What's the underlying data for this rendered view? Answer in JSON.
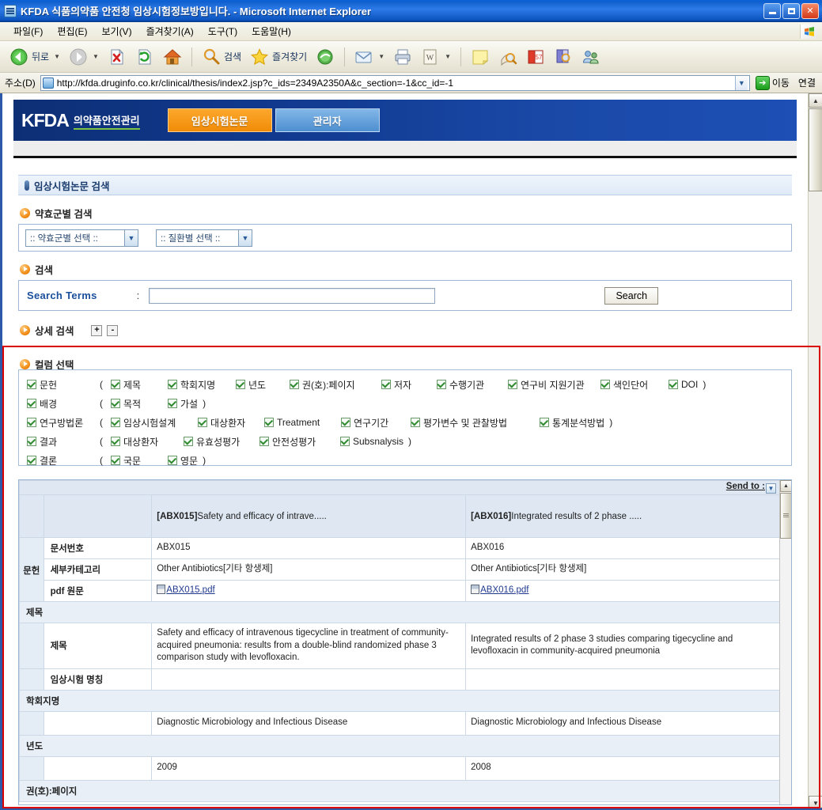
{
  "window": {
    "title": "KFDA 식품의약품 안전청 임상시험정보방입니다. - Microsoft Internet Explorer",
    "icon": "ie-page-icon",
    "minimize": "minimize-button",
    "maximize": "maximize-button",
    "close": "close-button"
  },
  "menu": {
    "items": [
      {
        "label": "파일(F)"
      },
      {
        "label": "편집(E)"
      },
      {
        "label": "보기(V)"
      },
      {
        "label": "즐겨찾기(A)"
      },
      {
        "label": "도구(T)"
      },
      {
        "label": "도움말(H)"
      }
    ]
  },
  "toolbar": {
    "back_label": "뒤로",
    "search_label": "검색",
    "favorites_label": "즐겨찾기",
    "icons": [
      "back-icon",
      "forward-icon",
      "stop-icon",
      "refresh-icon",
      "home-icon",
      "search-icon",
      "favorites-star-icon",
      "history-icon",
      "mail-icon",
      "print-icon",
      "edit-icon",
      "notes-icon",
      "zoom-search-icon",
      "calendar-icon",
      "dictionary-icon",
      "messenger-icon"
    ]
  },
  "address": {
    "label": "주소(D)",
    "url": "http://kfda.druginfo.co.kr/clinical/thesis/index2.jsp?c_ids=2349A2350A&c_section=-1&cc_id=-1",
    "go_label": "이동",
    "links_label": "연결"
  },
  "site": {
    "brand_mark": "KFDA",
    "brand_sub": "의약품안전관리",
    "tabs": [
      {
        "label": "임상시험논문",
        "active": true
      },
      {
        "label": "관리자",
        "active": false
      }
    ]
  },
  "section": {
    "title": "임상시험논문 검색"
  },
  "drug_group_search": {
    "heading": "약효군별 검색",
    "select_drug_group": ":: 약효군별 선택 ::",
    "select_disease": ":: 질환별 선택 ::"
  },
  "search": {
    "heading": "검색",
    "terms_label": "Search Terms",
    "colon": ":",
    "value": "",
    "placeholder": "",
    "button_label": "Search"
  },
  "detail_search": {
    "heading": "상세 검색",
    "expand_label": "+",
    "collapse_label": "-"
  },
  "column_select": {
    "heading": "컬럼 선택",
    "rows": [
      {
        "main": "문헌",
        "open": "(",
        "close": ")",
        "children": [
          "제목",
          "학회지명",
          "년도",
          "권(호):페이지",
          "저자",
          "수행기관",
          "연구비 지원기관",
          "색인단어",
          "DOI"
        ]
      },
      {
        "main": "배경",
        "open": "(",
        "close": ")",
        "children": [
          "목적",
          "가설"
        ]
      },
      {
        "main": "연구방법론",
        "open": "(",
        "close": ")",
        "children": [
          "임상시험설계",
          "대상환자",
          "Treatment",
          "연구기간",
          "평가변수 및 관찰방법",
          "통계분석방법"
        ]
      },
      {
        "main": "결과",
        "open": "(",
        "close": ")",
        "children": [
          "대상환자",
          "유효성평가",
          "안전성평가",
          "Subsnalysis"
        ]
      },
      {
        "main": "결론",
        "open": "(",
        "close": ")",
        "children": [
          "국문",
          "영문"
        ]
      }
    ]
  },
  "results": {
    "send_to_label": "Send to :",
    "documents": [
      {
        "code": "[ABX015]",
        "title_short": "Safety and efficacy of intrave....."
      },
      {
        "code": "[ABX016]",
        "title_short": "Integrated results of 2 phase ....."
      }
    ],
    "group_label": "문헌",
    "rows": [
      {
        "label": "문서번호",
        "type": "text",
        "values": [
          "ABX015",
          "ABX016"
        ]
      },
      {
        "label": "세부카테고리",
        "type": "text",
        "values": [
          "Other Antibiotics[기타 항생제]",
          "Other Antibiotics[기타 항생제]"
        ]
      },
      {
        "label": "pdf 원문",
        "type": "link",
        "values": [
          "ABX015.pdf",
          "ABX016.pdf"
        ]
      }
    ],
    "sections": [
      {
        "heading": "제목",
        "rows": [
          {
            "label": "제목",
            "values": [
              "Safety and efficacy of intravenous tigecycline in treatment of community-acquired pneumonia: results from a double-blind randomized phase 3 comparison study with levofloxacin.",
              "Integrated results of 2 phase 3 studies comparing tigecycline and levofloxacin in community-acquired pneumonia"
            ]
          },
          {
            "label": "임상시험 명칭",
            "values": [
              "",
              ""
            ]
          }
        ]
      },
      {
        "heading": "학회지명",
        "rows": [
          {
            "label": "",
            "values": [
              "Diagnostic Microbiology and Infectious Disease",
              "Diagnostic Microbiology and Infectious Disease"
            ]
          }
        ]
      },
      {
        "heading": "년도",
        "rows": [
          {
            "label": "",
            "values": [
              "2009",
              "2008"
            ]
          }
        ]
      },
      {
        "heading": "권(호):페이지",
        "rows": []
      }
    ]
  },
  "colors": {
    "accent_orange": "#f18c08",
    "header_blue": "#1a49a8",
    "link_purple": "#9c2e9c",
    "annotation_red": "#d80000",
    "label_blue": "#17406f"
  }
}
